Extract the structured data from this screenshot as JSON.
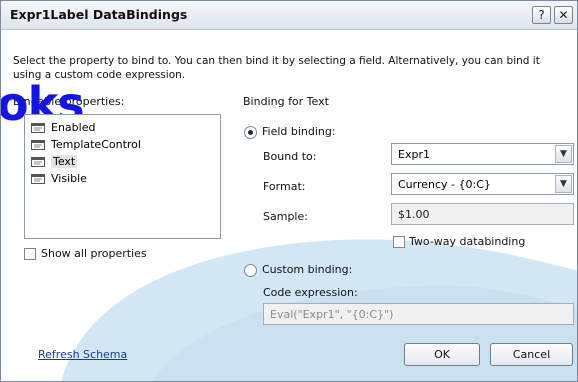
{
  "window": {
    "title": "Expr1Label DataBindings",
    "help_glyph": "?",
    "close_glyph": "✕"
  },
  "description": "Select the property to bind to. You can then bind it by selecting a field. Alternatively, you can bind it using a custom code expression.",
  "overlay_text": "oks",
  "properties": {
    "label": "Bindable properties:",
    "items": [
      {
        "label": "Enabled",
        "icon": "property-icon",
        "selected": false
      },
      {
        "label": "TemplateControl",
        "icon": "property-icon",
        "selected": false
      },
      {
        "label": "Text",
        "icon": "property-icon",
        "selected": true
      },
      {
        "label": "Visible",
        "icon": "property-icon",
        "selected": false
      }
    ],
    "show_all_label": "Show all properties",
    "show_all_checked": false
  },
  "binding": {
    "group_label": "Binding for Text",
    "field_binding_label": "Field binding:",
    "field_binding_selected": true,
    "bound_to_label": "Bound to:",
    "bound_to_value": "Expr1",
    "format_label": "Format:",
    "format_value": "Currency - {0:C}",
    "sample_label": "Sample:",
    "sample_value": "$1.00",
    "two_way_label": "Two-way databinding",
    "two_way_checked": false,
    "custom_binding_label": "Custom binding:",
    "custom_binding_selected": false,
    "code_expression_label": "Code expression:",
    "code_expression_value": "Eval(\"Expr1\", \"{0:C}\")"
  },
  "footer": {
    "refresh_link": "Refresh Schema",
    "ok_label": "OK",
    "cancel_label": "Cancel"
  },
  "colors": {
    "accent_wave": "#cfe3f3",
    "overlay_text": "#1515e0",
    "link": "#1a3c8c"
  }
}
